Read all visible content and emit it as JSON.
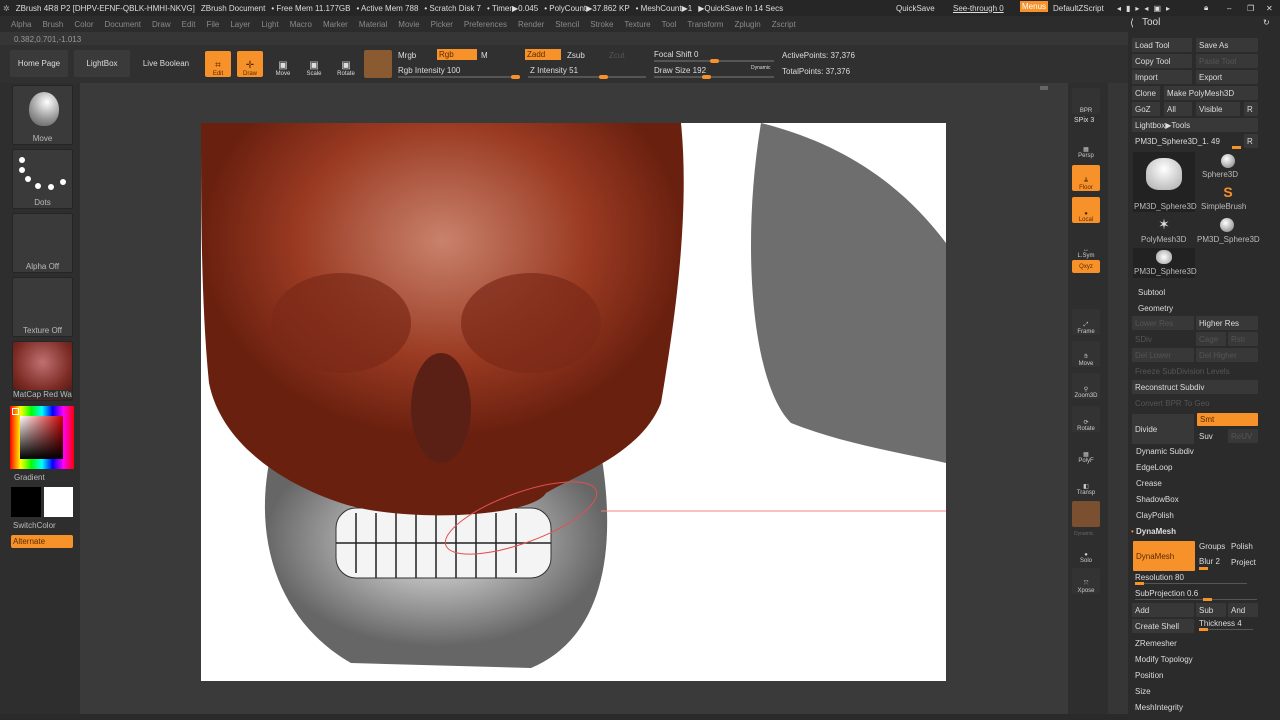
{
  "title_bar": {
    "app": "ZBrush 4R8 P2 [DHPV-EFNF-QBLK-HMHI-NKVG]",
    "document": "ZBrush Document",
    "free_mem": "• Free Mem 11.177GB",
    "active_mem": "• Active Mem 788",
    "scratch": "• Scratch Disk 7",
    "timer": "• Timer▶0.045",
    "polycount": "• PolyCount▶37.862 KP",
    "meshcount": "• MeshCount▶1",
    "quicksave_in": "▶QuickSave In 14 Secs",
    "quicksave": "QuickSave",
    "see_through": "See-through  0",
    "menus": "Menus",
    "script": "DefaultZScript"
  },
  "menu": [
    "Alpha",
    "Brush",
    "Color",
    "Document",
    "Draw",
    "Edit",
    "File",
    "Layer",
    "Light",
    "Macro",
    "Marker",
    "Material",
    "Movie",
    "Picker",
    "Preferences",
    "Render",
    "Stencil",
    "Stroke",
    "Texture",
    "Tool",
    "Transform",
    "Zplugin",
    "Zscript"
  ],
  "coords": "0.382,0.701,-1.013",
  "toolbar": {
    "home": "Home Page",
    "lightbox": "LightBox",
    "live_boolean": "Live Boolean",
    "edit": "Edit",
    "draw": "Draw",
    "move": "Move",
    "scale": "Scale",
    "rotate": "Rotate",
    "mrgb": "Mrgb",
    "rgb": "Rgb",
    "m": "M",
    "rgb_intensity": "Rgb Intensity 100",
    "zadd": "Zadd",
    "zsub": "Zsub",
    "zcut": "Zcut",
    "z_intensity": "Z Intensity 51",
    "focal_shift": "Focal Shift 0",
    "draw_size": "Draw Size 192",
    "dynamic": "Dynamic",
    "active_points": "ActivePoints: 37,376",
    "total_points": "TotalPoints: 37,376",
    "rgb_intensity_value": 100,
    "z_intensity_value": 51
  },
  "left_shelf": {
    "brush": "Move",
    "stroke": "Dots",
    "alpha": "Alpha Off",
    "texture": "Texture Off",
    "material": "MatCap Red Wax",
    "gradient": "Gradient",
    "switch_color": "SwitchColor",
    "alternate": "Alternate",
    "colors": {
      "main": "#000000",
      "secondary": "#ffffff"
    }
  },
  "right_shelf": [
    "BPR",
    "SPix 3",
    "Persp",
    "Floor",
    "Local",
    "L.Sym",
    "Qxyz",
    "Frame",
    "Move",
    "Zoom3D",
    "Rotate",
    "PolyF",
    "Transp",
    "Dynamic",
    "Solo",
    "Xpose"
  ],
  "tool_panel": {
    "title": "Tool",
    "load_tool": "Load Tool",
    "save_as": "Save As",
    "copy_tool": "Copy Tool",
    "paste_tool": "Paste Tool",
    "import": "Import",
    "export": "Export",
    "clone": "Clone",
    "make_polymesh": "Make PolyMesh3D",
    "goz": "GoZ",
    "all": "All",
    "visible": "Visible",
    "r": "R",
    "lightbox_tools": "Lightbox▶Tools",
    "current_tool": "PM3D_Sphere3D_1. 49",
    "tools": [
      "PM3D_Sphere3D",
      "Sphere3D",
      "SimpleBrush",
      "PolyMesh3D",
      "PM3D_Sphere3D",
      "PM3D_Sphere3D"
    ],
    "subtool": "Subtool",
    "geometry": "Geometry",
    "lower_res": "Lower Res",
    "higher_res": "Higher Res",
    "sdiv": "SDiv",
    "cage": "Cage",
    "rstr": "Rstr",
    "del_lower": "Del Lower",
    "del_higher": "Del Higher",
    "freeze": "Freeze SubDivision Levels",
    "reconstruct": "Reconstruct Subdiv",
    "convert_bpr": "Convert BPR To Geo",
    "divide": "Divide",
    "smt": "Smt",
    "suv": "Suv",
    "reluv": "ReUV",
    "dynamic_subdiv": "Dynamic Subdiv",
    "edgeloop": "EdgeLoop",
    "crease": "Crease",
    "shadowbox": "ShadowBox",
    "claypolish": "ClayPolish",
    "dynamesh_section": "DynaMesh",
    "dynamesh": "DynaMesh",
    "groups": "Groups",
    "polish": "Polish",
    "blur": "Blur 2",
    "project": "Project",
    "resolution": "Resolution 80",
    "subprojection": "SubProjection 0.6",
    "add": "Add",
    "sub": "Sub",
    "and": "And",
    "create_shell": "Create Shell",
    "thickness": "Thickness 4",
    "zremesher": "ZRemesher",
    "modify_topology": "Modify Topology",
    "position": "Position",
    "size": "Size",
    "meshintegrity": "MeshIntegrity"
  },
  "accent": "#f7912a"
}
